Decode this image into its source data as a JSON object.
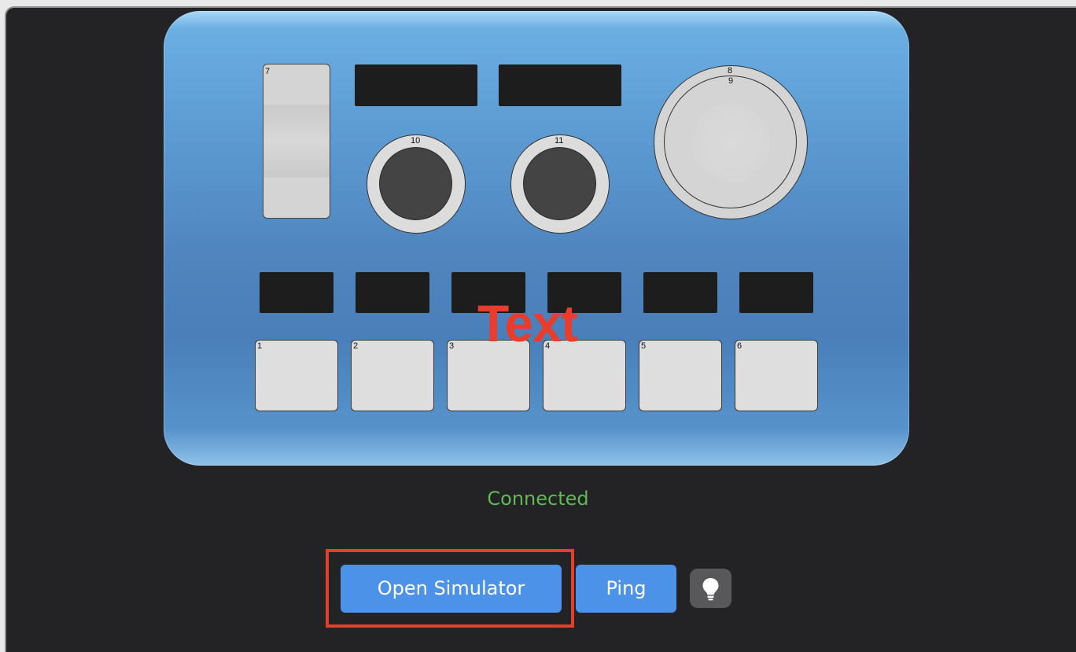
{
  "device": {
    "fader_number": "7",
    "knobs": [
      {
        "number": "10"
      },
      {
        "number": "11"
      }
    ],
    "jog_wheel": {
      "number_outer": "8",
      "number_inner": "9"
    },
    "pads": [
      {
        "number": "1"
      },
      {
        "number": "2"
      },
      {
        "number": "3"
      },
      {
        "number": "4"
      },
      {
        "number": "5"
      },
      {
        "number": "6"
      }
    ],
    "overlay_text": "Text"
  },
  "status": {
    "text": "Connected",
    "color": "#5fb955"
  },
  "buttons": {
    "open_simulator_label": "Open Simulator",
    "ping_label": "Ping",
    "bulb_icon": "lightbulb-icon"
  },
  "colors": {
    "accent_blue": "#4b92e8",
    "highlight_red": "#e2402c",
    "overlay_red": "#ea3c2c",
    "panel_bg": "#232325"
  }
}
